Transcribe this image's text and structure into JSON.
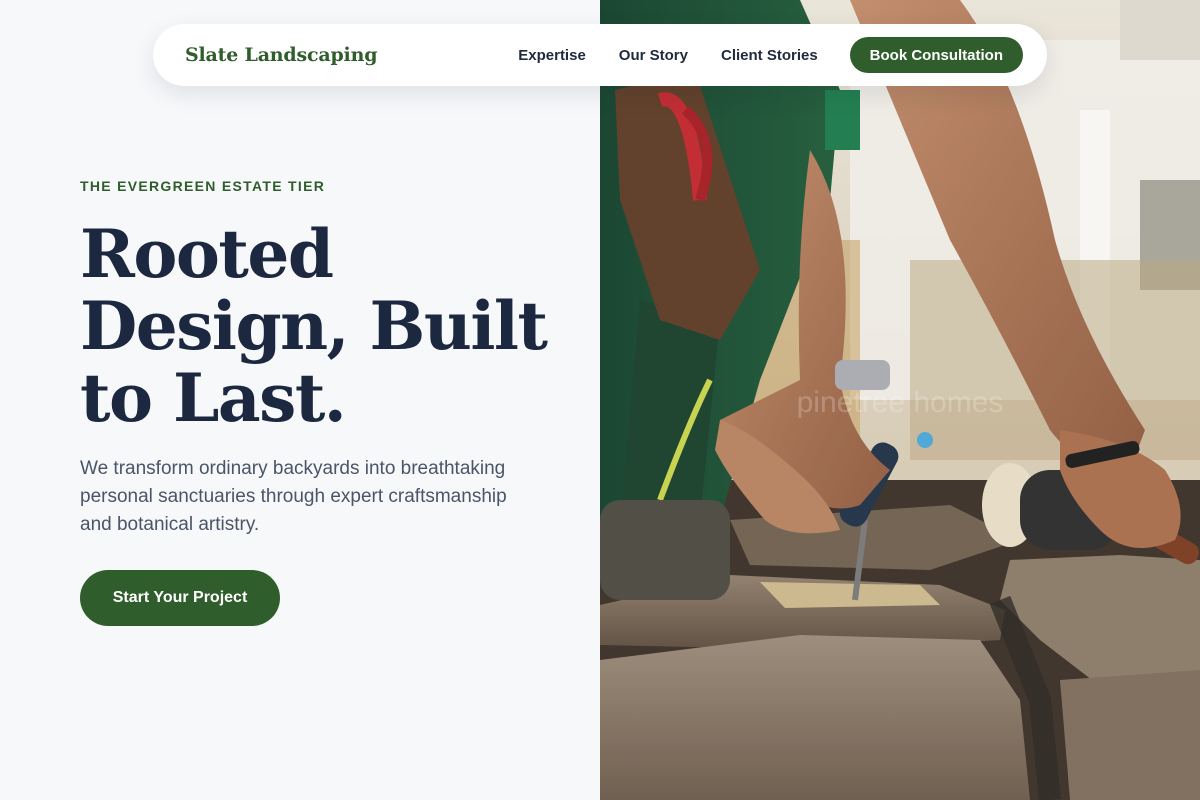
{
  "nav": {
    "brand": "Slate Landscaping",
    "links": [
      "Expertise",
      "Our Story",
      "Client Stories"
    ],
    "cta": "Book Consultation"
  },
  "hero": {
    "eyebrow": "THE EVERGREEN ESTATE TIER",
    "headline": "Rooted Design, Built to Last.",
    "subtext": "We transform ordinary backyards into breathtaking personal sanctuaries through expert craftsmanship and botanical artistry.",
    "cta": "Start Your Project",
    "image_watermark": "pinetree homes"
  },
  "colors": {
    "brand_green": "#2f5d2b",
    "heading_navy": "#1c2740",
    "body_gray": "#4a5568",
    "page_bg": "#f6f8fa"
  }
}
